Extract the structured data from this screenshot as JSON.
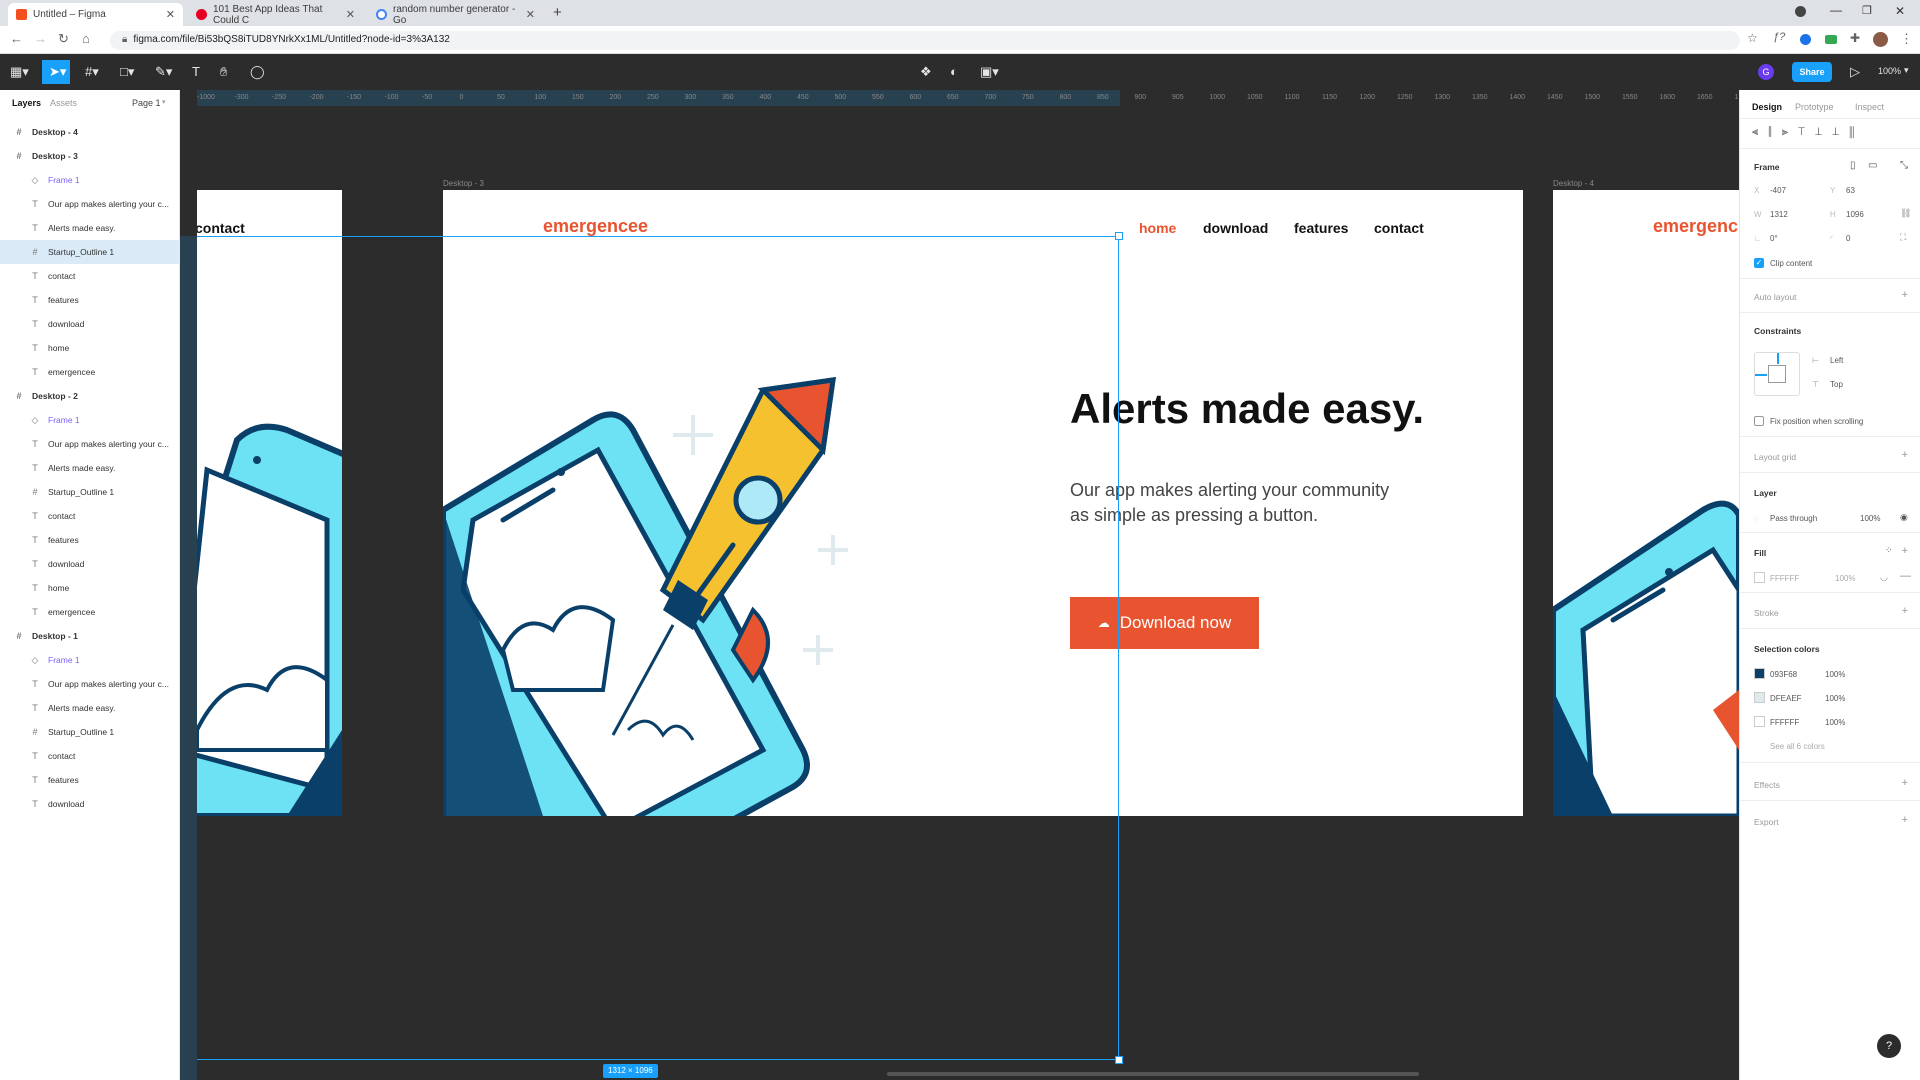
{
  "browser": {
    "tabs": [
      {
        "title": "Untitled – Figma",
        "color": "#f24e1e"
      },
      {
        "title": "101 Best App Ideas That Could C",
        "color": "#e60023"
      },
      {
        "title": "random number generator - Go",
        "color": "#4285f4"
      }
    ],
    "new_tab": "+",
    "url": "figma.com/file/Bi53bQS8iTUD8YNrkXx1ML/Untitled?node-id=3%3A132"
  },
  "toolbar": {
    "share_label": "Share",
    "zoom": "100%",
    "avatar_letter": "G"
  },
  "layers_panel": {
    "tab_layers": "Layers",
    "tab_assets": "Assets",
    "page": "Page 1",
    "items": [
      {
        "label": "Desktop - 4",
        "kind": "frame"
      },
      {
        "label": "Desktop - 3",
        "kind": "frame"
      },
      {
        "label": "Frame 1",
        "kind": "comp"
      },
      {
        "label": "Our app makes alerting your c...",
        "kind": "text"
      },
      {
        "label": "Alerts made easy.",
        "kind": "text"
      },
      {
        "label": "Startup_Outline 1",
        "kind": "group",
        "selected": true
      },
      {
        "label": "contact",
        "kind": "text"
      },
      {
        "label": "features",
        "kind": "text"
      },
      {
        "label": "download",
        "kind": "text"
      },
      {
        "label": "home",
        "kind": "text"
      },
      {
        "label": "emergencee",
        "kind": "text"
      },
      {
        "label": "Desktop - 2",
        "kind": "frame"
      },
      {
        "label": "Frame 1",
        "kind": "comp"
      },
      {
        "label": "Our app makes alerting your c...",
        "kind": "text"
      },
      {
        "label": "Alerts made easy.",
        "kind": "text"
      },
      {
        "label": "Startup_Outline 1",
        "kind": "group"
      },
      {
        "label": "contact",
        "kind": "text"
      },
      {
        "label": "features",
        "kind": "text"
      },
      {
        "label": "download",
        "kind": "text"
      },
      {
        "label": "home",
        "kind": "text"
      },
      {
        "label": "emergencee",
        "kind": "text"
      },
      {
        "label": "Desktop - 1",
        "kind": "frame"
      },
      {
        "label": "Frame 1",
        "kind": "comp"
      },
      {
        "label": "Our app makes alerting your c...",
        "kind": "text"
      },
      {
        "label": "Alerts made easy.",
        "kind": "text"
      },
      {
        "label": "Startup_Outline 1",
        "kind": "group"
      },
      {
        "label": "contact",
        "kind": "text"
      },
      {
        "label": "features",
        "kind": "text"
      },
      {
        "label": "download",
        "kind": "text"
      }
    ]
  },
  "ruler": {
    "ticks": [
      "-1000",
      "-300",
      "-250",
      "-200",
      "-150",
      "-100",
      "-50",
      "0",
      "50",
      "100",
      "150",
      "200",
      "250",
      "300",
      "350",
      "400",
      "450",
      "500",
      "550",
      "600",
      "650",
      "700",
      "750",
      "800",
      "850",
      "900",
      "905",
      "1000",
      "1050",
      "1100",
      "1150",
      "1200",
      "1250",
      "1300",
      "1350",
      "1400",
      "1450",
      "1500",
      "1550",
      "1600",
      "1650",
      "1700"
    ]
  },
  "canvas": {
    "frame_label_main": "Desktop - 3",
    "frame_label_right": "Desktop - 4",
    "left_frame_nav": "contact",
    "site": {
      "logo": "emergencee",
      "nav": [
        "home",
        "download",
        "features",
        "contact"
      ],
      "headline": "Alerts made easy.",
      "body": "Our app makes alerting your community as simple as pressing a button.",
      "cta": "Download now"
    },
    "right_frame_logo": "emergenc",
    "selection_size": "1312 × 1096",
    "accent": "#e8542f"
  },
  "design_panel": {
    "tabs": [
      "Design",
      "Prototype",
      "Inspect"
    ],
    "frame_label": "Frame",
    "x_label": "X",
    "x": "-407",
    "y_label": "Y",
    "y": "63",
    "w_label": "W",
    "w": "1312",
    "h_label": "H",
    "h": "1096",
    "rotation": "0°",
    "radius": "0",
    "clip_content": "Clip content",
    "auto_layout": "Auto layout",
    "constraints": "Constraints",
    "constraint_h": "Left",
    "constraint_v": "Top",
    "fix_position": "Fix position when scrolling",
    "layout_grid": "Layout grid",
    "layer": "Layer",
    "blend": "Pass through",
    "opacity": "100%",
    "fill": "Fill",
    "fill_hex": "FFFFFF",
    "fill_opacity": "100%",
    "stroke": "Stroke",
    "selection_colors": "Selection colors",
    "colors": [
      {
        "hex": "093F68",
        "opacity": "100%",
        "swatch": "#093f68"
      },
      {
        "hex": "DFEAEF",
        "opacity": "100%",
        "swatch": "#dfeaef"
      },
      {
        "hex": "FFFFFF",
        "opacity": "100%",
        "swatch": "#ffffff"
      }
    ],
    "see_all": "See all 6 colors",
    "effects": "Effects",
    "export": "Export",
    "help": "?"
  }
}
